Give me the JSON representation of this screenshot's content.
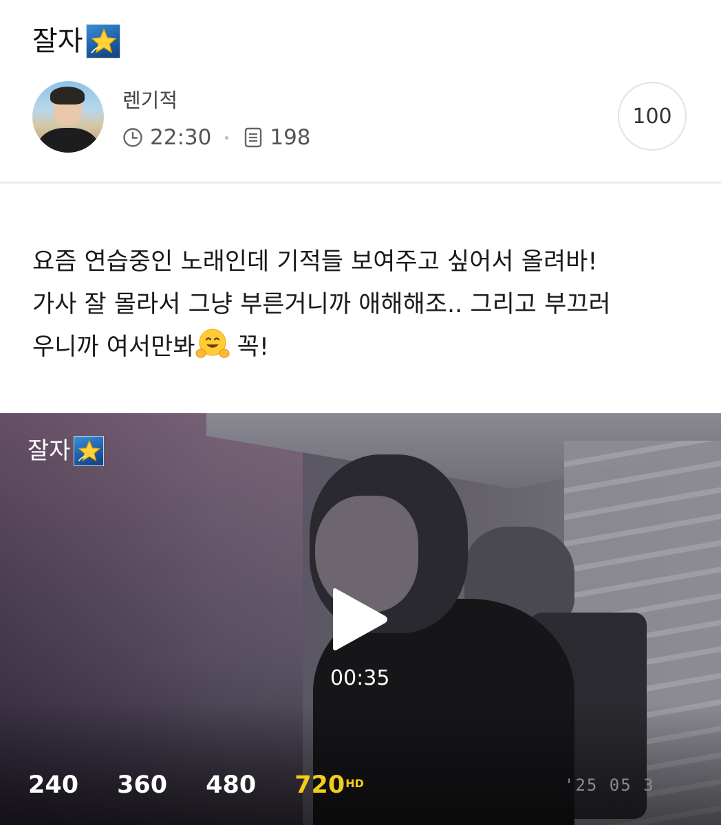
{
  "post": {
    "title": "잘자",
    "title_emoji": "dizzy-star-emoji",
    "author": {
      "name": "렌기적",
      "time": "22:30",
      "views": "198"
    },
    "count_badge": "100",
    "body_lines": [
      "요즘 연습중인 노래인데 기적들 보여주고 싶어서 올려바!",
      "가사 잘 몰라서 그냥 부른거니까 애해해조.. 그리고 부끄러",
      "우니까 여서만봐",
      "꼭!"
    ],
    "body_emoji": "hugging-face-emoji"
  },
  "video": {
    "title": "잘자",
    "duration": "00:35",
    "qualities": [
      {
        "label": "240",
        "badge": ""
      },
      {
        "label": "360",
        "badge": ""
      },
      {
        "label": "480",
        "badge": ""
      },
      {
        "label": "720",
        "badge": "HD"
      }
    ],
    "selected_quality": "720",
    "timestamp_overlay": "'25 05 3"
  },
  "colors": {
    "selected_quality": "#f3cc1a",
    "divider": "#ececec",
    "text_primary": "#111111",
    "text_secondary": "#555555"
  }
}
